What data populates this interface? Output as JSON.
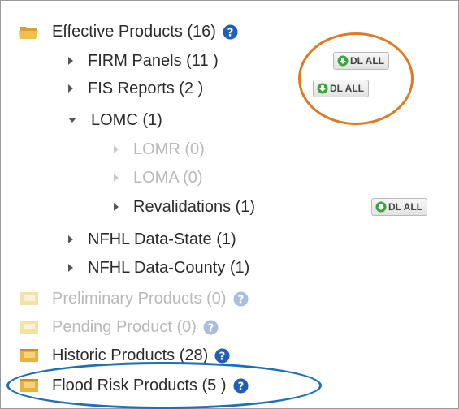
{
  "tree": {
    "effective": {
      "label": "Effective Products (16)"
    },
    "firm": {
      "label": "FIRM Panels (11 )"
    },
    "fis": {
      "label": "FIS Reports (2 )"
    },
    "lomc": {
      "label": "LOMC (1)"
    },
    "lomr": {
      "label": "LOMR (0)"
    },
    "loma": {
      "label": "LOMA (0)"
    },
    "revalidations": {
      "label": "Revalidations (1)"
    },
    "nfhl_state": {
      "label": "NFHL Data-State (1)"
    },
    "nfhl_county": {
      "label": "NFHL Data-County (1)"
    },
    "preliminary": {
      "label": "Preliminary Products (0)"
    },
    "pending": {
      "label": "Pending Product (0)"
    },
    "historic": {
      "label": "Historic Products (28)"
    },
    "flood_risk": {
      "label": "Flood Risk Products (5 )"
    }
  },
  "buttons": {
    "dl_all": "DL ALL"
  },
  "colors": {
    "folder": "#e8b23c",
    "help": "#1f5fb8",
    "orange_ring": "#e07a22",
    "blue_ring": "#1f6fb7",
    "dl_arrow": "#3aa53a"
  }
}
